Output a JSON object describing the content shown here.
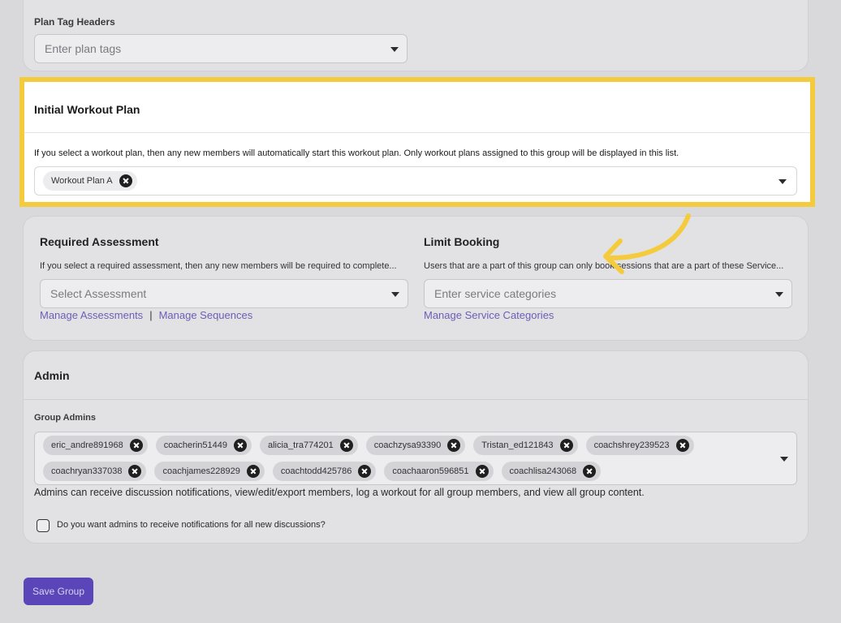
{
  "plan_tags": {
    "label": "Plan Tag Headers",
    "placeholder": "Enter plan tags"
  },
  "initial_workout": {
    "title": "Initial Workout Plan",
    "description": "If you select a workout plan, then any new members will automatically start this workout plan. Only workout plans assigned to this group will be displayed in this list.",
    "selected_chip": "Workout Plan A"
  },
  "required_assessment": {
    "title": "Required Assessment",
    "description": "If you select a required assessment, then any new members will be required to complete...",
    "placeholder": "Select Assessment",
    "link_assessments": "Manage Assessments",
    "separator": "|",
    "link_sequences": "Manage Sequences"
  },
  "limit_booking": {
    "title": "Limit Booking",
    "description": "Users that are a part of this group can only book sessions that are a part of these Service...",
    "placeholder": "Enter service categories",
    "link": "Manage Service Categories"
  },
  "admin": {
    "title": "Admin",
    "group_admins_label": "Group Admins",
    "admins": [
      "eric_andre891968",
      "coacherin51449",
      "alicia_tra774201",
      "coachzysa93390",
      "Tristan_ed121843",
      "coachshrey239523",
      "coachryan337038",
      "coachjames228929",
      "coachtodd425786",
      "coachaaron596851",
      "coachlisa243068"
    ],
    "help_text": "Admins can receive discussion notifications, view/edit/export members, log a workout for all group members, and view all group content.",
    "notify_question": "Do you want admins to receive notifications for all new discussions?"
  },
  "save_label": "Save Group",
  "colors": {
    "highlight": "#f5cb3e",
    "accent": "#5a46b8",
    "link": "#6b5fb5",
    "annotation_arrow": "#f5cb3e"
  }
}
